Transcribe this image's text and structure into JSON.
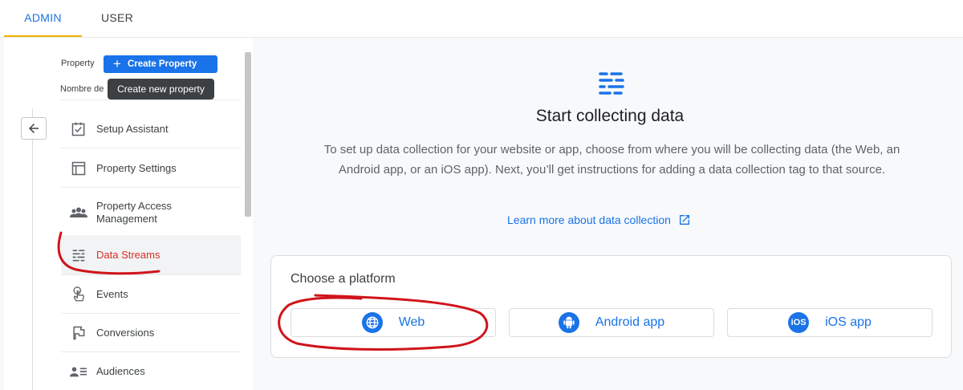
{
  "tabs": [
    {
      "label": "ADMIN",
      "active": true
    },
    {
      "label": "USER",
      "active": false
    }
  ],
  "left_panel": {
    "property_label": "Property",
    "create_property_label": "Create Property",
    "nombre_label": "Nombre de",
    "tooltip": "Create new property",
    "nav": [
      {
        "label": "Setup Assistant",
        "icon": "checkbox-check-icon"
      },
      {
        "label": "Property Settings",
        "icon": "layout-icon"
      },
      {
        "label": "Property Access Management",
        "icon": "people-icon"
      },
      {
        "label": "Data Streams",
        "icon": "data-streams-icon",
        "active": true
      },
      {
        "label": "Events",
        "icon": "touch-icon"
      },
      {
        "label": "Conversions",
        "icon": "flag-icon"
      },
      {
        "label": "Audiences",
        "icon": "audience-icon"
      }
    ]
  },
  "main": {
    "title": "Start collecting data",
    "description": "To set up data collection for your website or app, choose from where you will be collecting data (the Web, an Android app, or an iOS app). Next, you’ll get instructions for adding a data collection tag to that source.",
    "learn_more": "Learn more about data collection",
    "choose_platform": "Choose a platform",
    "platforms": [
      {
        "label": "Web",
        "icon": "globe-icon"
      },
      {
        "label": "Android app",
        "icon": "android-icon"
      },
      {
        "label": "iOS app",
        "icon": "ios-icon",
        "icon_text": "iOS"
      }
    ]
  },
  "colors": {
    "accent": "#1a73e8",
    "tab_underline": "#f0b100",
    "annotation": "#d0141b",
    "active_nav_text": "#d93025"
  }
}
